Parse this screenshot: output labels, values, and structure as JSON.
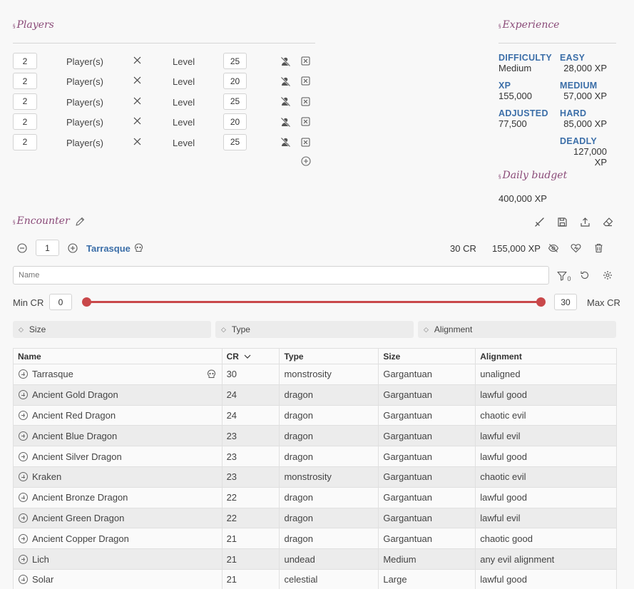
{
  "players": {
    "title": "Players",
    "rows": [
      {
        "count": "2",
        "players_label": "Player(s)",
        "level_label": "Level",
        "level": "25"
      },
      {
        "count": "2",
        "players_label": "Player(s)",
        "level_label": "Level",
        "level": "20"
      },
      {
        "count": "2",
        "players_label": "Player(s)",
        "level_label": "Level",
        "level": "25"
      },
      {
        "count": "2",
        "players_label": "Player(s)",
        "level_label": "Level",
        "level": "20"
      },
      {
        "count": "2",
        "players_label": "Player(s)",
        "level_label": "Level",
        "level": "25"
      }
    ]
  },
  "experience": {
    "title": "Experience",
    "difficulty_label": "DIFFICULTY",
    "difficulty_value": "Medium",
    "xp_label": "XP",
    "xp_value": "155,000",
    "adjusted_label": "ADJUSTED",
    "adjusted_value": "77,500",
    "easy_label": "EASY",
    "easy_value": "28,000 XP",
    "medium_label": "MEDIUM",
    "medium_value": "57,000 XP",
    "hard_label": "HARD",
    "hard_value": "85,000 XP",
    "deadly_label": "DEADLY",
    "deadly_value": "127,000 XP",
    "daily_title": "Daily budget",
    "daily_value": "400,000 XP"
  },
  "encounter": {
    "title": "Encounter",
    "quantity": "1",
    "monster_name": "Tarrasque",
    "cr": "30 CR",
    "xp": "155,000 XP"
  },
  "filters": {
    "name_placeholder": "Name",
    "filter_count": "0",
    "min_cr_label": "Min CR",
    "min_cr": "0",
    "max_cr_label": "Max CR",
    "max_cr": "30",
    "slider_accent": "#c9484a",
    "size_label": "Size",
    "type_label": "Type",
    "alignment_label": "Alignment"
  },
  "table": {
    "headers": {
      "name": "Name",
      "cr": "CR",
      "type": "Type",
      "size": "Size",
      "alignment": "Alignment"
    },
    "rows": [
      {
        "name": "Tarrasque",
        "cr": "30",
        "type": "monstrosity",
        "size": "Gargantuan",
        "alignment": "unaligned"
      },
      {
        "name": "Ancient Gold Dragon",
        "cr": "24",
        "type": "dragon",
        "size": "Gargantuan",
        "alignment": "lawful good"
      },
      {
        "name": "Ancient Red Dragon",
        "cr": "24",
        "type": "dragon",
        "size": "Gargantuan",
        "alignment": "chaotic evil"
      },
      {
        "name": "Ancient Blue Dragon",
        "cr": "23",
        "type": "dragon",
        "size": "Gargantuan",
        "alignment": "lawful evil"
      },
      {
        "name": "Ancient Silver Dragon",
        "cr": "23",
        "type": "dragon",
        "size": "Gargantuan",
        "alignment": "lawful good"
      },
      {
        "name": "Kraken",
        "cr": "23",
        "type": "monstrosity",
        "size": "Gargantuan",
        "alignment": "chaotic evil"
      },
      {
        "name": "Ancient Bronze Dragon",
        "cr": "22",
        "type": "dragon",
        "size": "Gargantuan",
        "alignment": "lawful good"
      },
      {
        "name": "Ancient Green Dragon",
        "cr": "22",
        "type": "dragon",
        "size": "Gargantuan",
        "alignment": "lawful evil"
      },
      {
        "name": "Ancient Copper Dragon",
        "cr": "21",
        "type": "dragon",
        "size": "Gargantuan",
        "alignment": "chaotic good"
      },
      {
        "name": "Lich",
        "cr": "21",
        "type": "undead",
        "size": "Medium",
        "alignment": "any evil alignment"
      },
      {
        "name": "Solar",
        "cr": "21",
        "type": "celestial",
        "size": "Large",
        "alignment": "lawful good"
      }
    ]
  }
}
